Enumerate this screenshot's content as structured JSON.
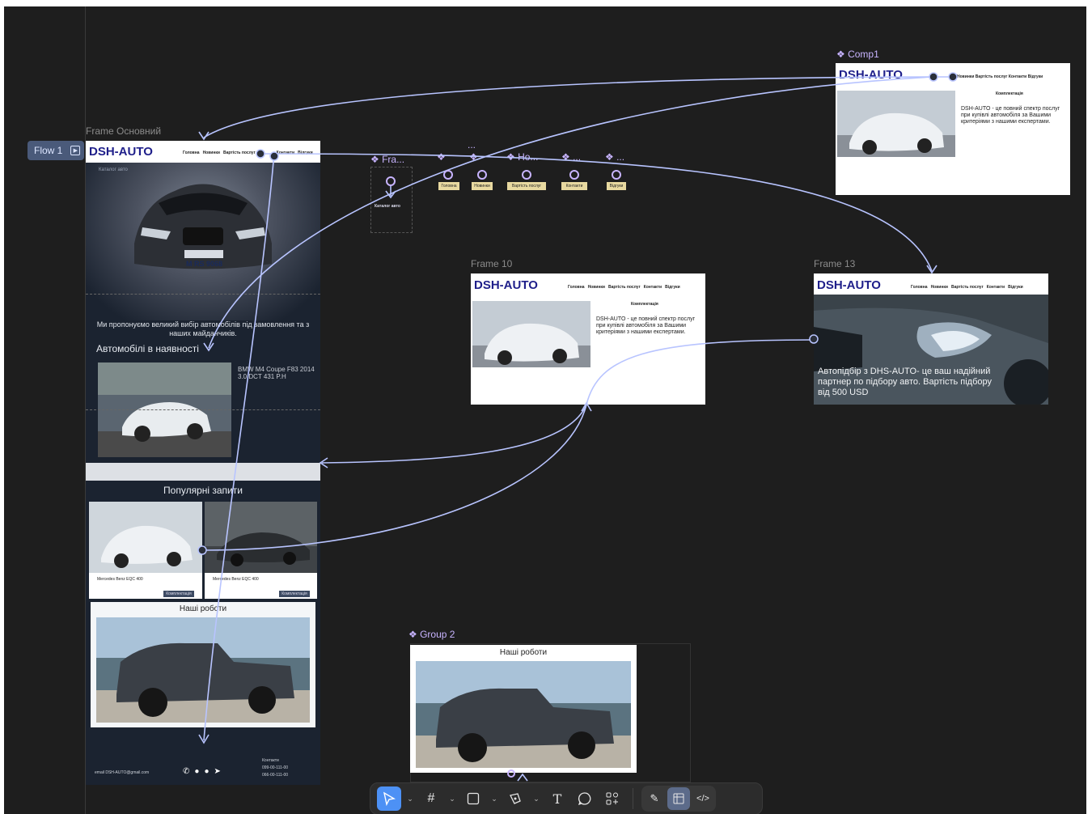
{
  "flow_label": "Flow 1",
  "frames": {
    "main_label": "Frame Основний",
    "comp1_label": "Comp1",
    "frame10_label": "Frame 10",
    "frame13_label": "Frame 13",
    "group2_label": "Group 2",
    "fra_label": "Fra...",
    "ho_label": "Ho...",
    "dots_label": "...",
    "dots_label_2": "..."
  },
  "site": {
    "logo": "DSH-AUTO",
    "logo_comp1": "DSH-AUTO",
    "nav": [
      "Головна",
      "Новинки",
      "Вартість послуг",
      "Контакти",
      "Відгуки"
    ],
    "nav_comp1": "Новинки  Вартість послуг  Контакти  Відгуки",
    "catalog": "Каталог авто",
    "plate": "M RS 9068",
    "offer": "Ми пропонуємо великий вибір автомобілів під замовлення та з наших майданчиків.",
    "in_stock_title": "Автомобілі в наявності",
    "in_stock_car": "BMW M4 Coupe F83 2014",
    "in_stock_specs": "3.0 DCT   431 P.H",
    "popular_title": "Популярні запити",
    "popular_car_1": "Mercedes Benz EQC 400",
    "popular_car_2": "Mercedes Benz EQC 400",
    "equipment_btn": "Комплектація",
    "works_title": "Наші роботи",
    "footer_email": "email  DSH-AUTO@gmail.com",
    "contacts_title": "Контакти",
    "phone_1": "099-00-111-00",
    "phone_2": "066-00-111-00",
    "equipment_title": "Комплектація",
    "desc": "DSH-AUTO - це повний спектр послуг при купівлі автомобіля за Вашими критеріями з нашими експертами.",
    "hero13": "Автопідбір з DHS-AUTO- це ваш надійний партнер по підбору авто. Вартість підбору від 500 USD"
  },
  "buttons_row": [
    "Головна",
    "Новинки",
    "Вартість послуг",
    "Контакти",
    "Відгуки"
  ],
  "toolbar": {
    "tools": [
      "move-tool",
      "frame-tool",
      "shape-tool",
      "pen-tool",
      "text-tool",
      "comment-tool",
      "actions-tool"
    ],
    "modes": [
      "draw-mode",
      "design-mode",
      "dev-mode"
    ]
  },
  "colors": {
    "canvas": "#1e1e1e",
    "connector": "#b8c4ff",
    "component": "#c8b4ff",
    "flow_tag": "#4a5a7a",
    "active_tool": "#4d91f5",
    "logo": "#1f1f8a"
  }
}
